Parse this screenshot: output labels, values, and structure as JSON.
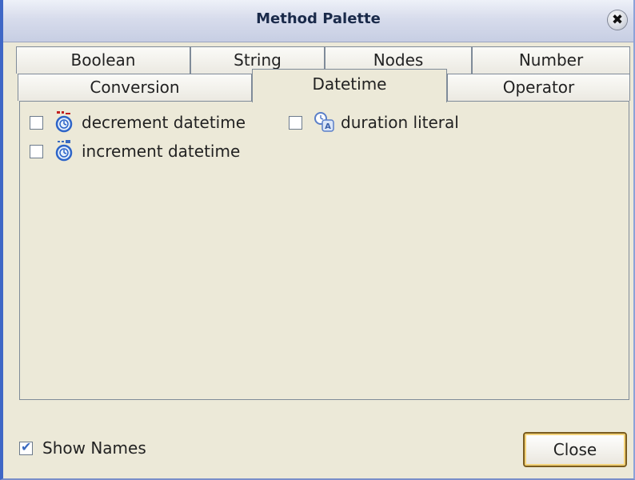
{
  "window": {
    "title": "Method Palette"
  },
  "tabs": {
    "row1": [
      "Boolean",
      "String",
      "Nodes",
      "Number"
    ],
    "row2": [
      "Conversion",
      "Datetime",
      "Operator"
    ],
    "selected": "Datetime"
  },
  "items": [
    {
      "label": "decrement datetime",
      "icon": "stopwatch-decrement-icon"
    },
    {
      "label": "duration literal",
      "icon": "duration-literal-icon"
    },
    {
      "label": "increment datetime",
      "icon": "stopwatch-increment-icon"
    }
  ],
  "footer": {
    "show_names_label": "Show Names",
    "show_names_checked": true,
    "close_label": "Close"
  },
  "colors": {
    "title_bar": "#d7dcec",
    "panel_bg": "#ece9d8",
    "border_accent": "#3f67c6",
    "button_focus": "#f3d37a"
  }
}
